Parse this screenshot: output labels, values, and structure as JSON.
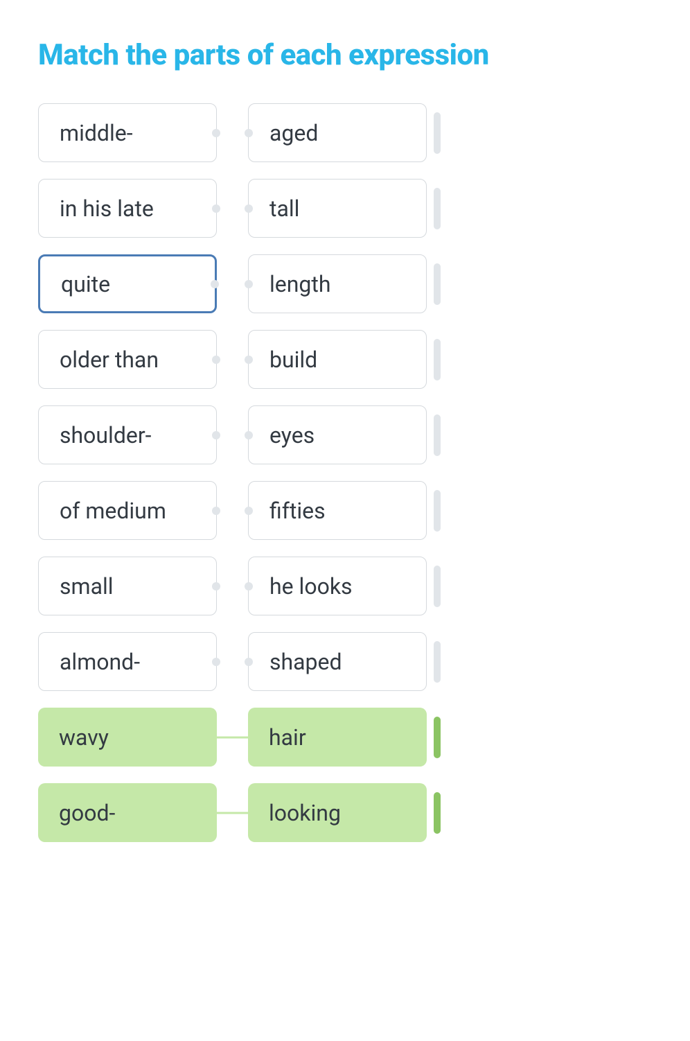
{
  "title": "Match the parts of each expression",
  "rows": [
    {
      "left": "middle-",
      "right": "aged",
      "matched": false,
      "selected": false
    },
    {
      "left": "in his late",
      "right": "tall",
      "matched": false,
      "selected": false
    },
    {
      "left": "quite",
      "right": "length",
      "matched": false,
      "selected": true
    },
    {
      "left": "older than",
      "right": "build",
      "matched": false,
      "selected": false
    },
    {
      "left": "shoulder-",
      "right": "eyes",
      "matched": false,
      "selected": false
    },
    {
      "left": "of medium",
      "right": "fifties",
      "matched": false,
      "selected": false
    },
    {
      "left": "small",
      "right": "he looks",
      "matched": false,
      "selected": false
    },
    {
      "left": "almond-",
      "right": "shaped",
      "matched": false,
      "selected": false
    },
    {
      "left": "wavy",
      "right": "hair",
      "matched": true,
      "selected": false
    },
    {
      "left": "good-",
      "right": "looking",
      "matched": true,
      "selected": false
    }
  ]
}
